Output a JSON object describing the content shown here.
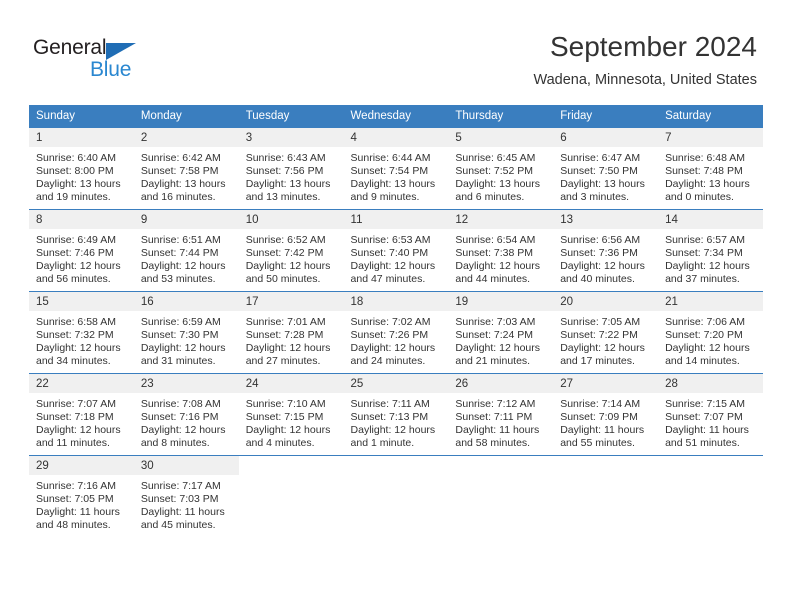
{
  "logo": {
    "text_top": "General",
    "text_bottom": "Blue",
    "triangle_color": "#1f6db5",
    "bottom_color": "#2a87d0"
  },
  "header": {
    "title": "September 2024",
    "subtitle": "Wadena, Minnesota, United States"
  },
  "theme": {
    "header_bar": "#3a7ebf",
    "daynum_bg": "#f0f0f0",
    "text": "#333333"
  },
  "calendar": {
    "weekday_headers": [
      "Sunday",
      "Monday",
      "Tuesday",
      "Wednesday",
      "Thursday",
      "Friday",
      "Saturday"
    ],
    "weeks": [
      [
        {
          "day": "1",
          "sunrise": "Sunrise: 6:40 AM",
          "sunset": "Sunset: 8:00 PM",
          "daylight_1": "Daylight: 13 hours",
          "daylight_2": "and 19 minutes."
        },
        {
          "day": "2",
          "sunrise": "Sunrise: 6:42 AM",
          "sunset": "Sunset: 7:58 PM",
          "daylight_1": "Daylight: 13 hours",
          "daylight_2": "and 16 minutes."
        },
        {
          "day": "3",
          "sunrise": "Sunrise: 6:43 AM",
          "sunset": "Sunset: 7:56 PM",
          "daylight_1": "Daylight: 13 hours",
          "daylight_2": "and 13 minutes."
        },
        {
          "day": "4",
          "sunrise": "Sunrise: 6:44 AM",
          "sunset": "Sunset: 7:54 PM",
          "daylight_1": "Daylight: 13 hours",
          "daylight_2": "and 9 minutes."
        },
        {
          "day": "5",
          "sunrise": "Sunrise: 6:45 AM",
          "sunset": "Sunset: 7:52 PM",
          "daylight_1": "Daylight: 13 hours",
          "daylight_2": "and 6 minutes."
        },
        {
          "day": "6",
          "sunrise": "Sunrise: 6:47 AM",
          "sunset": "Sunset: 7:50 PM",
          "daylight_1": "Daylight: 13 hours",
          "daylight_2": "and 3 minutes."
        },
        {
          "day": "7",
          "sunrise": "Sunrise: 6:48 AM",
          "sunset": "Sunset: 7:48 PM",
          "daylight_1": "Daylight: 13 hours",
          "daylight_2": "and 0 minutes."
        }
      ],
      [
        {
          "day": "8",
          "sunrise": "Sunrise: 6:49 AM",
          "sunset": "Sunset: 7:46 PM",
          "daylight_1": "Daylight: 12 hours",
          "daylight_2": "and 56 minutes."
        },
        {
          "day": "9",
          "sunrise": "Sunrise: 6:51 AM",
          "sunset": "Sunset: 7:44 PM",
          "daylight_1": "Daylight: 12 hours",
          "daylight_2": "and 53 minutes."
        },
        {
          "day": "10",
          "sunrise": "Sunrise: 6:52 AM",
          "sunset": "Sunset: 7:42 PM",
          "daylight_1": "Daylight: 12 hours",
          "daylight_2": "and 50 minutes."
        },
        {
          "day": "11",
          "sunrise": "Sunrise: 6:53 AM",
          "sunset": "Sunset: 7:40 PM",
          "daylight_1": "Daylight: 12 hours",
          "daylight_2": "and 47 minutes."
        },
        {
          "day": "12",
          "sunrise": "Sunrise: 6:54 AM",
          "sunset": "Sunset: 7:38 PM",
          "daylight_1": "Daylight: 12 hours",
          "daylight_2": "and 44 minutes."
        },
        {
          "day": "13",
          "sunrise": "Sunrise: 6:56 AM",
          "sunset": "Sunset: 7:36 PM",
          "daylight_1": "Daylight: 12 hours",
          "daylight_2": "and 40 minutes."
        },
        {
          "day": "14",
          "sunrise": "Sunrise: 6:57 AM",
          "sunset": "Sunset: 7:34 PM",
          "daylight_1": "Daylight: 12 hours",
          "daylight_2": "and 37 minutes."
        }
      ],
      [
        {
          "day": "15",
          "sunrise": "Sunrise: 6:58 AM",
          "sunset": "Sunset: 7:32 PM",
          "daylight_1": "Daylight: 12 hours",
          "daylight_2": "and 34 minutes."
        },
        {
          "day": "16",
          "sunrise": "Sunrise: 6:59 AM",
          "sunset": "Sunset: 7:30 PM",
          "daylight_1": "Daylight: 12 hours",
          "daylight_2": "and 31 minutes."
        },
        {
          "day": "17",
          "sunrise": "Sunrise: 7:01 AM",
          "sunset": "Sunset: 7:28 PM",
          "daylight_1": "Daylight: 12 hours",
          "daylight_2": "and 27 minutes."
        },
        {
          "day": "18",
          "sunrise": "Sunrise: 7:02 AM",
          "sunset": "Sunset: 7:26 PM",
          "daylight_1": "Daylight: 12 hours",
          "daylight_2": "and 24 minutes."
        },
        {
          "day": "19",
          "sunrise": "Sunrise: 7:03 AM",
          "sunset": "Sunset: 7:24 PM",
          "daylight_1": "Daylight: 12 hours",
          "daylight_2": "and 21 minutes."
        },
        {
          "day": "20",
          "sunrise": "Sunrise: 7:05 AM",
          "sunset": "Sunset: 7:22 PM",
          "daylight_1": "Daylight: 12 hours",
          "daylight_2": "and 17 minutes."
        },
        {
          "day": "21",
          "sunrise": "Sunrise: 7:06 AM",
          "sunset": "Sunset: 7:20 PM",
          "daylight_1": "Daylight: 12 hours",
          "daylight_2": "and 14 minutes."
        }
      ],
      [
        {
          "day": "22",
          "sunrise": "Sunrise: 7:07 AM",
          "sunset": "Sunset: 7:18 PM",
          "daylight_1": "Daylight: 12 hours",
          "daylight_2": "and 11 minutes."
        },
        {
          "day": "23",
          "sunrise": "Sunrise: 7:08 AM",
          "sunset": "Sunset: 7:16 PM",
          "daylight_1": "Daylight: 12 hours",
          "daylight_2": "and 8 minutes."
        },
        {
          "day": "24",
          "sunrise": "Sunrise: 7:10 AM",
          "sunset": "Sunset: 7:15 PM",
          "daylight_1": "Daylight: 12 hours",
          "daylight_2": "and 4 minutes."
        },
        {
          "day": "25",
          "sunrise": "Sunrise: 7:11 AM",
          "sunset": "Sunset: 7:13 PM",
          "daylight_1": "Daylight: 12 hours",
          "daylight_2": "and 1 minute."
        },
        {
          "day": "26",
          "sunrise": "Sunrise: 7:12 AM",
          "sunset": "Sunset: 7:11 PM",
          "daylight_1": "Daylight: 11 hours",
          "daylight_2": "and 58 minutes."
        },
        {
          "day": "27",
          "sunrise": "Sunrise: 7:14 AM",
          "sunset": "Sunset: 7:09 PM",
          "daylight_1": "Daylight: 11 hours",
          "daylight_2": "and 55 minutes."
        },
        {
          "day": "28",
          "sunrise": "Sunrise: 7:15 AM",
          "sunset": "Sunset: 7:07 PM",
          "daylight_1": "Daylight: 11 hours",
          "daylight_2": "and 51 minutes."
        }
      ],
      [
        {
          "day": "29",
          "sunrise": "Sunrise: 7:16 AM",
          "sunset": "Sunset: 7:05 PM",
          "daylight_1": "Daylight: 11 hours",
          "daylight_2": "and 48 minutes."
        },
        {
          "day": "30",
          "sunrise": "Sunrise: 7:17 AM",
          "sunset": "Sunset: 7:03 PM",
          "daylight_1": "Daylight: 11 hours",
          "daylight_2": "and 45 minutes."
        },
        {
          "day": "",
          "sunrise": "",
          "sunset": "",
          "daylight_1": "",
          "daylight_2": ""
        },
        {
          "day": "",
          "sunrise": "",
          "sunset": "",
          "daylight_1": "",
          "daylight_2": ""
        },
        {
          "day": "",
          "sunrise": "",
          "sunset": "",
          "daylight_1": "",
          "daylight_2": ""
        },
        {
          "day": "",
          "sunrise": "",
          "sunset": "",
          "daylight_1": "",
          "daylight_2": ""
        },
        {
          "day": "",
          "sunrise": "",
          "sunset": "",
          "daylight_1": "",
          "daylight_2": ""
        }
      ]
    ]
  }
}
